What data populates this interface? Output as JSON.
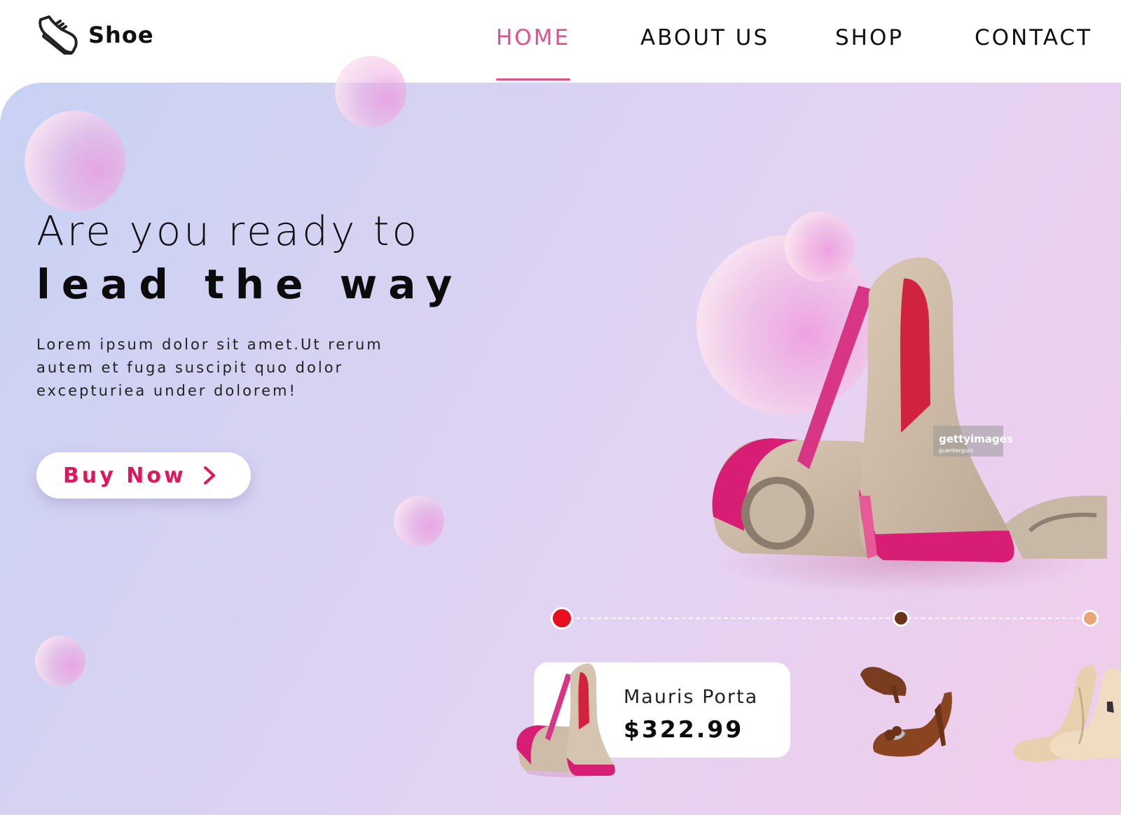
{
  "brand": {
    "name": "Shoe",
    "icon": "sneaker-icon"
  },
  "nav": {
    "items": [
      {
        "label": "HOME",
        "active": true
      },
      {
        "label": "ABOUT US",
        "active": false
      },
      {
        "label": "SHOP",
        "active": false
      },
      {
        "label": "CONTACT",
        "active": false
      }
    ]
  },
  "hero": {
    "headline_light": "Are you ready to",
    "headline_bold": "lead the way",
    "description": "Lorem ipsum dolor sit amet.Ut rerum autem et fuga suscipit quo dolor excepturiea under dolorem!",
    "cta_label": "Buy Now",
    "cta_icon": "chevron-right-icon"
  },
  "watermark": {
    "brand": "gettyimages",
    "credit": "guenterguni"
  },
  "color_options": [
    {
      "color": "#e8101e",
      "selected": true
    },
    {
      "color": "#6b3217",
      "selected": false
    },
    {
      "color": "#e9a57a",
      "selected": false
    }
  ],
  "featured_product": {
    "name": "Mauris Porta",
    "price": "$322.99"
  },
  "colors": {
    "accent": "#e0508a",
    "cta": "#e0155c",
    "text": "#111111"
  }
}
